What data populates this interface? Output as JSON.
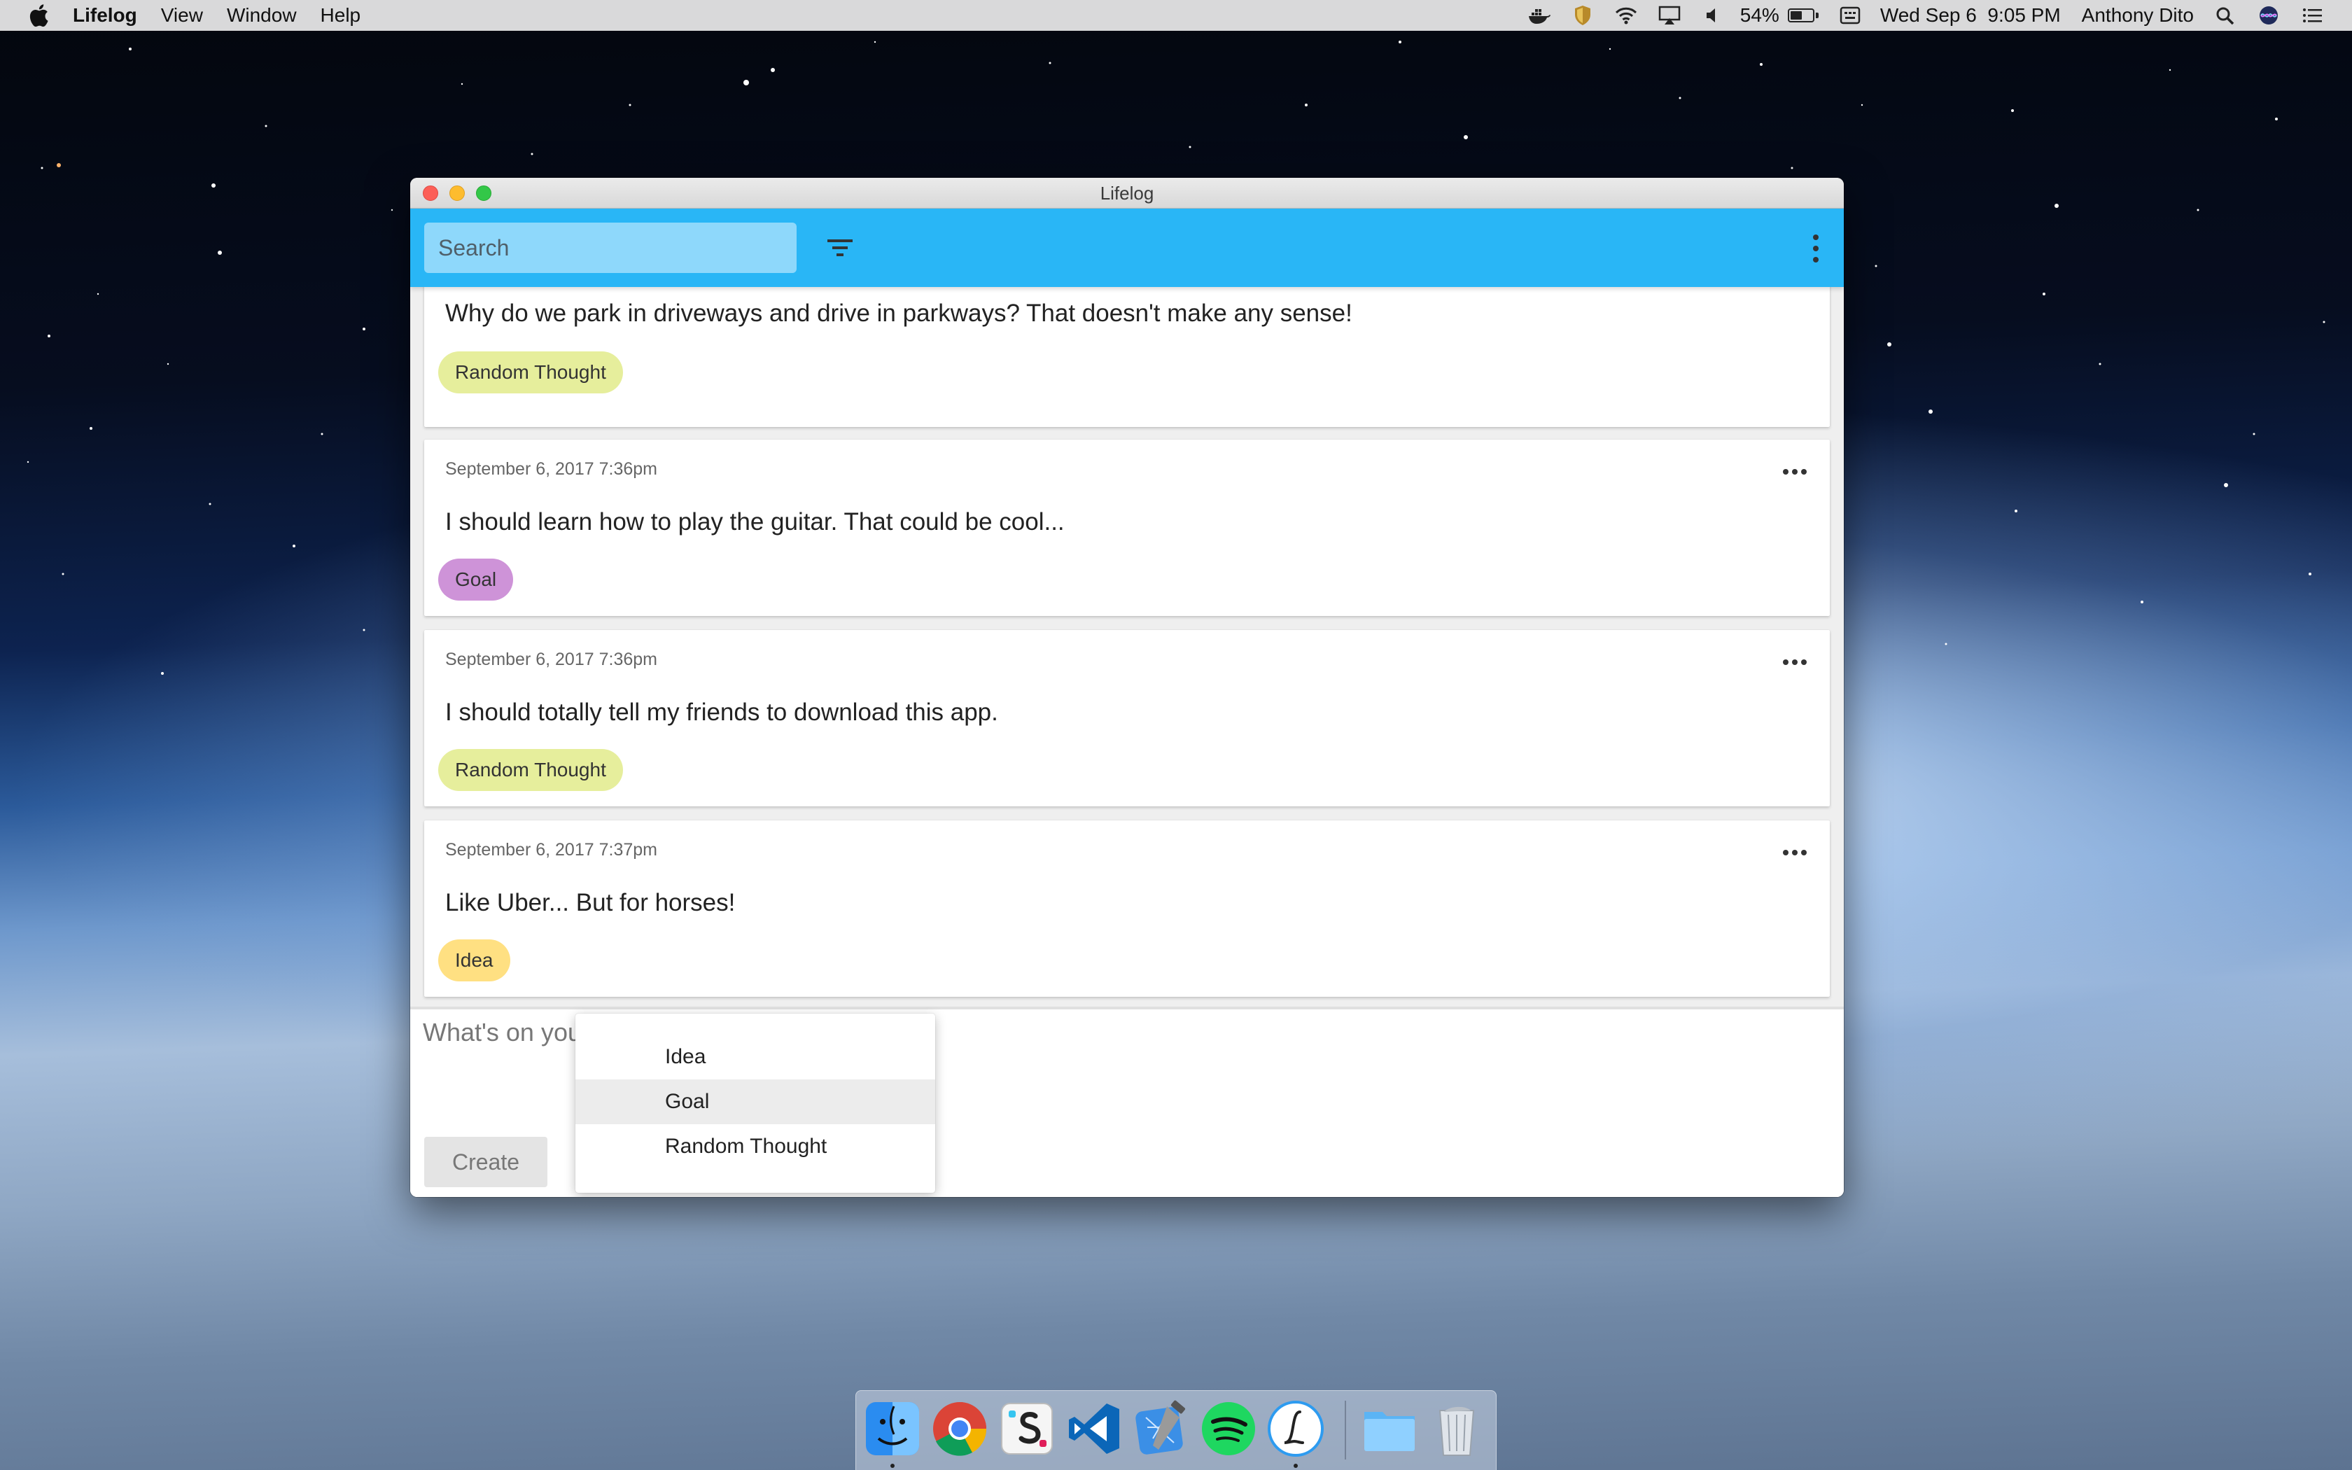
{
  "menubar": {
    "app_name": "Lifelog",
    "menus": [
      "View",
      "Window",
      "Help"
    ],
    "battery_percent": "54%",
    "battery_level": 0.54,
    "datetime": "Wed Sep 6  9:05 PM",
    "user_name": "Anthony Dito",
    "status_icons": [
      "docker-icon",
      "shield-icon",
      "wifi-icon",
      "airplay-icon",
      "volume-icon",
      "battery-icon",
      "keyboard-icon",
      "spotlight-icon",
      "siri-icon",
      "notification-center-icon"
    ]
  },
  "window": {
    "title": "Lifelog"
  },
  "toolbar": {
    "search_placeholder": "Search",
    "filter_icon": "filter-icon",
    "more_icon": "more-vert-icon"
  },
  "entries": [
    {
      "date": "",
      "text": "Why do we park in driveways and drive in parkways? That doesn't make any sense!",
      "tag": "Random Thought"
    },
    {
      "date": "September 6, 2017 7:36pm",
      "text": "I should learn how to play the guitar. That could be cool...",
      "tag": "Goal"
    },
    {
      "date": "September 6, 2017 7:36pm",
      "text": "I should totally tell my friends to download this app.",
      "tag": "Random Thought"
    },
    {
      "date": "September 6, 2017 7:37pm",
      "text": "Like Uber... But for horses!",
      "tag": "Idea"
    }
  ],
  "tag_colors": {
    "Random Thought": "#e6ee9c",
    "Goal": "#ce93d8",
    "Idea": "#ffe082"
  },
  "composer": {
    "placeholder": "What's on your mind?",
    "create_label": "Create"
  },
  "tag_dropdown": {
    "options": [
      "Idea",
      "Goal",
      "Random Thought"
    ],
    "highlighted": "Goal"
  },
  "dock": {
    "apps": [
      "finder-icon",
      "chrome-icon",
      "slack-icon",
      "vscode-icon",
      "xcode-icon",
      "spotify-icon",
      "lifelog-icon",
      "downloads-folder-icon",
      "trash-icon"
    ]
  },
  "colors": {
    "toolbar": "#29b6f6",
    "search_bg": "#8ed8fb"
  }
}
